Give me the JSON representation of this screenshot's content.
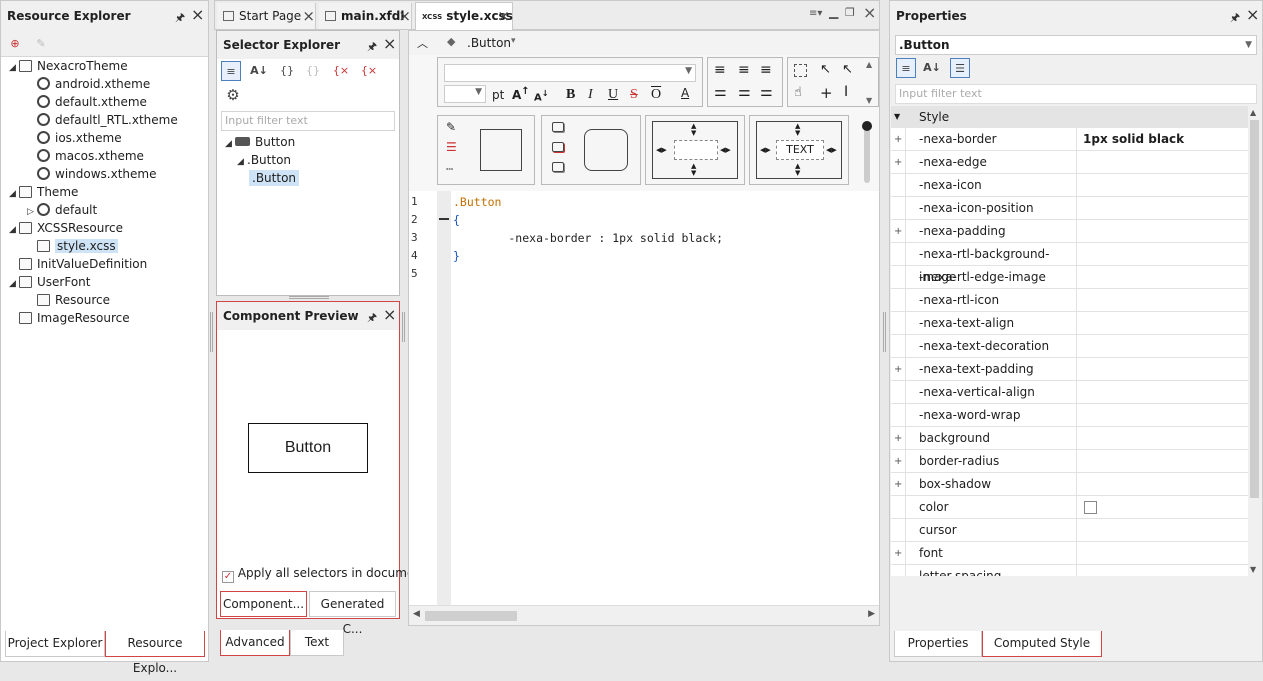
{
  "resource_explorer": {
    "title": "Resource Explorer",
    "items": [
      {
        "label": "NexacroTheme",
        "kind": "folder",
        "indent": 0,
        "expanded": true
      },
      {
        "label": "android.xtheme",
        "kind": "theme",
        "indent": 1
      },
      {
        "label": "default.xtheme",
        "kind": "theme",
        "indent": 1
      },
      {
        "label": "defaultl_RTL.xtheme",
        "kind": "theme",
        "indent": 1
      },
      {
        "label": "ios.xtheme",
        "kind": "theme",
        "indent": 1
      },
      {
        "label": "macos.xtheme",
        "kind": "theme",
        "indent": 1
      },
      {
        "label": "windows.xtheme",
        "kind": "theme",
        "indent": 1
      },
      {
        "label": "Theme",
        "kind": "folder",
        "indent": 0,
        "expanded": true
      },
      {
        "label": "default",
        "kind": "theme",
        "indent": 1,
        "collapsed": true
      },
      {
        "label": "XCSSResource",
        "kind": "folder",
        "indent": 0,
        "expanded": true
      },
      {
        "label": "style.xcss",
        "kind": "xcss",
        "indent": 1,
        "selected": true
      },
      {
        "label": "InitValueDefinition",
        "kind": "init",
        "indent": 0
      },
      {
        "label": "UserFont",
        "kind": "folder",
        "indent": 0,
        "expanded": true
      },
      {
        "label": "Resource",
        "kind": "font",
        "indent": 1
      },
      {
        "label": "ImageResource",
        "kind": "image",
        "indent": 0
      }
    ],
    "bottom_tabs": [
      "Project Explorer",
      "Resource Explo..."
    ]
  },
  "editor_tabs": [
    {
      "label": "Start Page"
    },
    {
      "label": "main.xfdl"
    },
    {
      "label": "style.xcss",
      "active": true
    }
  ],
  "selector_explorer": {
    "title": "Selector Explorer",
    "filter_placeholder": "Input filter text",
    "tree": [
      {
        "label": "Button",
        "indent": 0
      },
      {
        "label": ".Button",
        "indent": 1
      },
      {
        "label": ".Button",
        "indent": 2,
        "selected": true
      }
    ]
  },
  "component_preview": {
    "title": "Component Preview",
    "button_label": "Button",
    "apply_checkbox_label": "Apply all selectors in docume",
    "apply_checked": true,
    "tabs": [
      "Component...",
      "Generated C..."
    ]
  },
  "style_editor": {
    "breadcrumb": ".Button",
    "font_size_unit": "pt",
    "text_sample": "TEXT",
    "code_lines": [
      {
        "n": "1",
        "text": ".Button",
        "cls": "sel"
      },
      {
        "n": "2",
        "text": "{",
        "cls": "brace"
      },
      {
        "n": "3",
        "text": "        -nexa-border : 1px solid black;",
        "cls": "decl"
      },
      {
        "n": "4",
        "text": "}",
        "cls": "brace"
      },
      {
        "n": "5",
        "text": "",
        "cls": ""
      }
    ],
    "bottom_tabs": [
      "Advanced",
      "Text"
    ]
  },
  "properties": {
    "title": "Properties",
    "selector": ".Button",
    "filter_placeholder": "Input filter text",
    "section": "Style",
    "rows": [
      {
        "name": "-nexa-border",
        "value": "1px solid black",
        "plus": true
      },
      {
        "name": "-nexa-edge",
        "value": "",
        "plus": true
      },
      {
        "name": "-nexa-icon",
        "value": "",
        "plus": false
      },
      {
        "name": "-nexa-icon-position",
        "value": "",
        "plus": false
      },
      {
        "name": "-nexa-padding",
        "value": "",
        "plus": true
      },
      {
        "name": "-nexa-rtl-background-image",
        "value": "",
        "plus": false
      },
      {
        "name": "-nexa-rtl-edge-image",
        "value": "",
        "plus": false
      },
      {
        "name": "-nexa-rtl-icon",
        "value": "",
        "plus": false
      },
      {
        "name": "-nexa-text-align",
        "value": "",
        "plus": false
      },
      {
        "name": "-nexa-text-decoration",
        "value": "",
        "plus": false
      },
      {
        "name": "-nexa-text-padding",
        "value": "",
        "plus": true
      },
      {
        "name": "-nexa-vertical-align",
        "value": "",
        "plus": false
      },
      {
        "name": "-nexa-word-wrap",
        "value": "",
        "plus": false
      },
      {
        "name": "background",
        "value": "",
        "plus": true
      },
      {
        "name": "border-radius",
        "value": "",
        "plus": true
      },
      {
        "name": "box-shadow",
        "value": "",
        "plus": true
      },
      {
        "name": "color",
        "value": "",
        "plus": false,
        "swatch": true
      },
      {
        "name": "cursor",
        "value": "",
        "plus": false
      },
      {
        "name": "font",
        "value": "",
        "plus": true
      },
      {
        "name": "letter-spacing",
        "value": "",
        "plus": false
      }
    ],
    "bottom_tabs": [
      "Properties",
      "Computed Style"
    ]
  },
  "colors": {
    "accent_red": "#d04545",
    "selection": "#cfe3f7",
    "code_orange": "#c07000",
    "code_blue": "#1a55c0"
  }
}
